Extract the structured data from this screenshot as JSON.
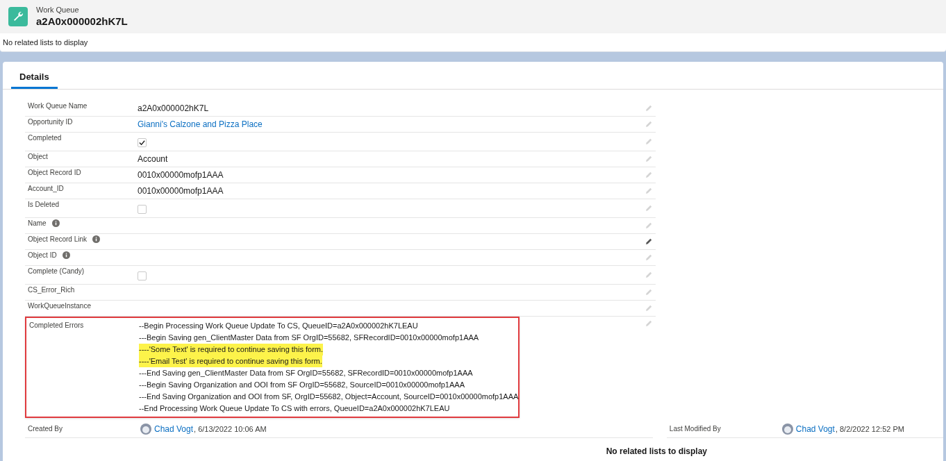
{
  "header": {
    "object_type": "Work Queue",
    "title": "a2A0x000002hK7L",
    "related_note": "No related lists to display"
  },
  "tabs": [
    {
      "label": "Details",
      "selected": true
    }
  ],
  "fields": [
    {
      "label": "Work Queue Name",
      "kind": "text",
      "value": "a2A0x000002hK7L",
      "info": false,
      "edit_highlighted": false
    },
    {
      "label": "Opportunity ID",
      "kind": "link",
      "value": "Gianni's Calzone and Pizza Place",
      "info": false,
      "edit_highlighted": false
    },
    {
      "label": "Completed",
      "kind": "checkbox",
      "checked": true,
      "info": false,
      "edit_highlighted": false
    },
    {
      "label": "Object",
      "kind": "text",
      "value": "Account",
      "info": false,
      "edit_highlighted": false
    },
    {
      "label": "Object Record ID",
      "kind": "text",
      "value": "0010x00000mofp1AAA",
      "info": false,
      "edit_highlighted": false
    },
    {
      "label": "Account_ID",
      "kind": "text",
      "value": "0010x00000mofp1AAA",
      "info": false,
      "edit_highlighted": false
    },
    {
      "label": "Is Deleted",
      "kind": "checkbox",
      "checked": false,
      "info": false,
      "edit_highlighted": false
    },
    {
      "label": "Name",
      "kind": "empty",
      "info": true,
      "edit_highlighted": false
    },
    {
      "label": "Object Record Link",
      "kind": "empty",
      "info": true,
      "edit_highlighted": true
    },
    {
      "label": "Object ID",
      "kind": "empty",
      "info": true,
      "edit_highlighted": false
    },
    {
      "label": "Complete (Candy)",
      "kind": "checkbox",
      "checked": false,
      "info": false,
      "edit_highlighted": false
    },
    {
      "label": "CS_Error_Rich",
      "kind": "empty",
      "info": false,
      "edit_highlighted": false
    },
    {
      "label": "WorkQueueInstance",
      "kind": "empty",
      "info": false,
      "edit_highlighted": false
    },
    {
      "label": "Completed Errors",
      "kind": "lines",
      "info": false,
      "edit_highlighted": false,
      "outlined": true,
      "lines": [
        {
          "text": "--Begin Processing Work Queue Update To CS, QueueID=a2A0x000002hK7LEAU",
          "highlight": false
        },
        {
          "text": "---Begin Saving gen_ClientMaster Data from SF OrgID=55682, SFRecordID=0010x00000mofp1AAA",
          "highlight": false
        },
        {
          "text": "----'Some Text' is required to continue saving this form.",
          "highlight": true
        },
        {
          "text": "----'Email Test' is required to continue saving this form.",
          "highlight": true
        },
        {
          "text": "---End Saving gen_ClientMaster Data from SF OrgID=55682, SFRecordID=0010x00000mofp1AAA",
          "highlight": false
        },
        {
          "text": "---Begin Saving Organization and OOI from SF OrgID=55682, SourceID=0010x00000mofp1AAA",
          "highlight": false
        },
        {
          "text": "---End Saving Organization and OOI from SF, OrgID=55682, Object=Account, SourceID=0010x00000mofp1AAA",
          "highlight": false
        },
        {
          "text": "--End Processing Work Queue Update To CS with errors, QueueID=a2A0x000002hK7LEAU",
          "highlight": false
        }
      ]
    }
  ],
  "created_by": {
    "label": "Created By",
    "user": "Chad Vogt",
    "date": ", 6/13/2022 10:06 AM"
  },
  "last_modified_by": {
    "label": "Last Modified By",
    "user": "Chad Vogt",
    "date": ", 8/2/2022 12:52 PM"
  },
  "footer_note": "No related lists to display"
}
